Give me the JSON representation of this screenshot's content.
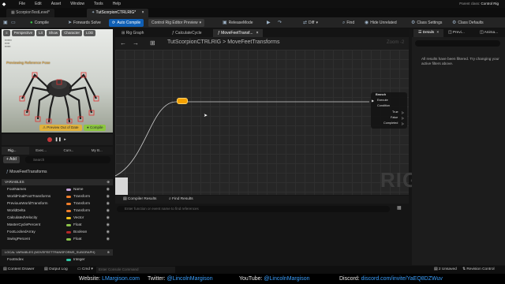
{
  "menu": {
    "items": [
      "File",
      "Edit",
      "Asset",
      "Window",
      "Tools",
      "Help"
    ],
    "parent_class_label": "Parent class:",
    "parent_class_value": "Control Rig"
  },
  "tabs": [
    "ScorpionTestLevel",
    "TutScorpionCTRLRIG"
  ],
  "toolbar": {
    "compile": "Compile",
    "forwards_solve": "Forwards Solve",
    "auto_compile": "Auto Compile",
    "preview_mode": "Control Rig Editor Preview",
    "release_mode": "ReleaseMode",
    "diff": "Diff",
    "find": "Find",
    "hide_unrelated": "Hide Unrelated",
    "class_settings": "Class Settings",
    "class_defaults": "Class Defaults"
  },
  "viewport": {
    "buttons": [
      "Perspective",
      "Lit",
      "Show",
      "Character",
      "LOD"
    ],
    "preview_label": "Previewing Reference Pose",
    "btn_prev": "Preview Out of Date",
    "btn_compile": "Compile"
  },
  "left_panel": {
    "tabs": [
      "Rig...",
      "Exec...",
      "Curv...",
      "My B..."
    ],
    "add_label": "+ Add",
    "search_placeholder": "Search",
    "graph_item": "MoveFeetTransforms",
    "variables_header": "VARIABLES",
    "variables": [
      {
        "name": "FootNames",
        "type": "Name",
        "color": "#c4a0d8"
      },
      {
        "name": "WorldFinalFootTransforms",
        "type": "Transform",
        "color": "#f07d2a"
      },
      {
        "name": "PreviousWorldTransform",
        "type": "Transform",
        "color": "#f07d2a"
      },
      {
        "name": "WorldDelta",
        "type": "Transform",
        "color": "#f07d2a"
      },
      {
        "name": "CalculatedVelocity",
        "type": "Vector",
        "color": "#f2c21b"
      },
      {
        "name": "MasterCyclePercent",
        "type": "Float",
        "color": "#8bc34a"
      },
      {
        "name": "FootLockedArray",
        "type": "Boolean",
        "color": "#b52828"
      },
      {
        "name": "SwingPercent",
        "type": "Float",
        "color": "#8bc34a"
      }
    ],
    "local_header": "LOCAL VARIABLES (MOVEFEETTRANSFORMS_SUBGRAPH)",
    "local_variables": [
      {
        "name": "FootIndex",
        "type": "Integer",
        "color": "#2ec6a4"
      }
    ]
  },
  "graph": {
    "tabs": [
      "Rig Graph",
      "CalculateCycle",
      "MoveFeetTransf..."
    ],
    "breadcrumb": [
      "TutScorpionCTRLRIG",
      "MoveFeetTransforms"
    ],
    "zoom": "Zoom -2",
    "watermark": "RIG",
    "branch_node": {
      "title": "Branch",
      "execute": "Execute",
      "condition": "Condition",
      "true": "True",
      "false": "False",
      "completed": "Completed"
    }
  },
  "results": {
    "tabs": [
      "Compiler Results",
      "Find Results"
    ],
    "search_placeholder": "Enter function or event name to find references"
  },
  "details": {
    "tabs": [
      "Details",
      "Previ...",
      "Anima..."
    ],
    "message": "All results have been filtered. Try changing your active filters above."
  },
  "status": {
    "content_drawer": "Content Drawer",
    "output_log": "Output Log",
    "cmd": "Cmd",
    "cmd_placeholder": "Enter Console Command",
    "unsaved": "2 Unsaved",
    "revision": "Revision Control"
  },
  "footer": {
    "website_label": "Website:",
    "website": "LMargison.com",
    "twitter_label": "Twitter:",
    "twitter": "@LincolnMargison",
    "youtube_label": "YouTube:",
    "youtube": "@LincolnMargison",
    "discord_label": "Discord:",
    "discord": "discord.com/invite/YaEQ8DZWuv"
  }
}
